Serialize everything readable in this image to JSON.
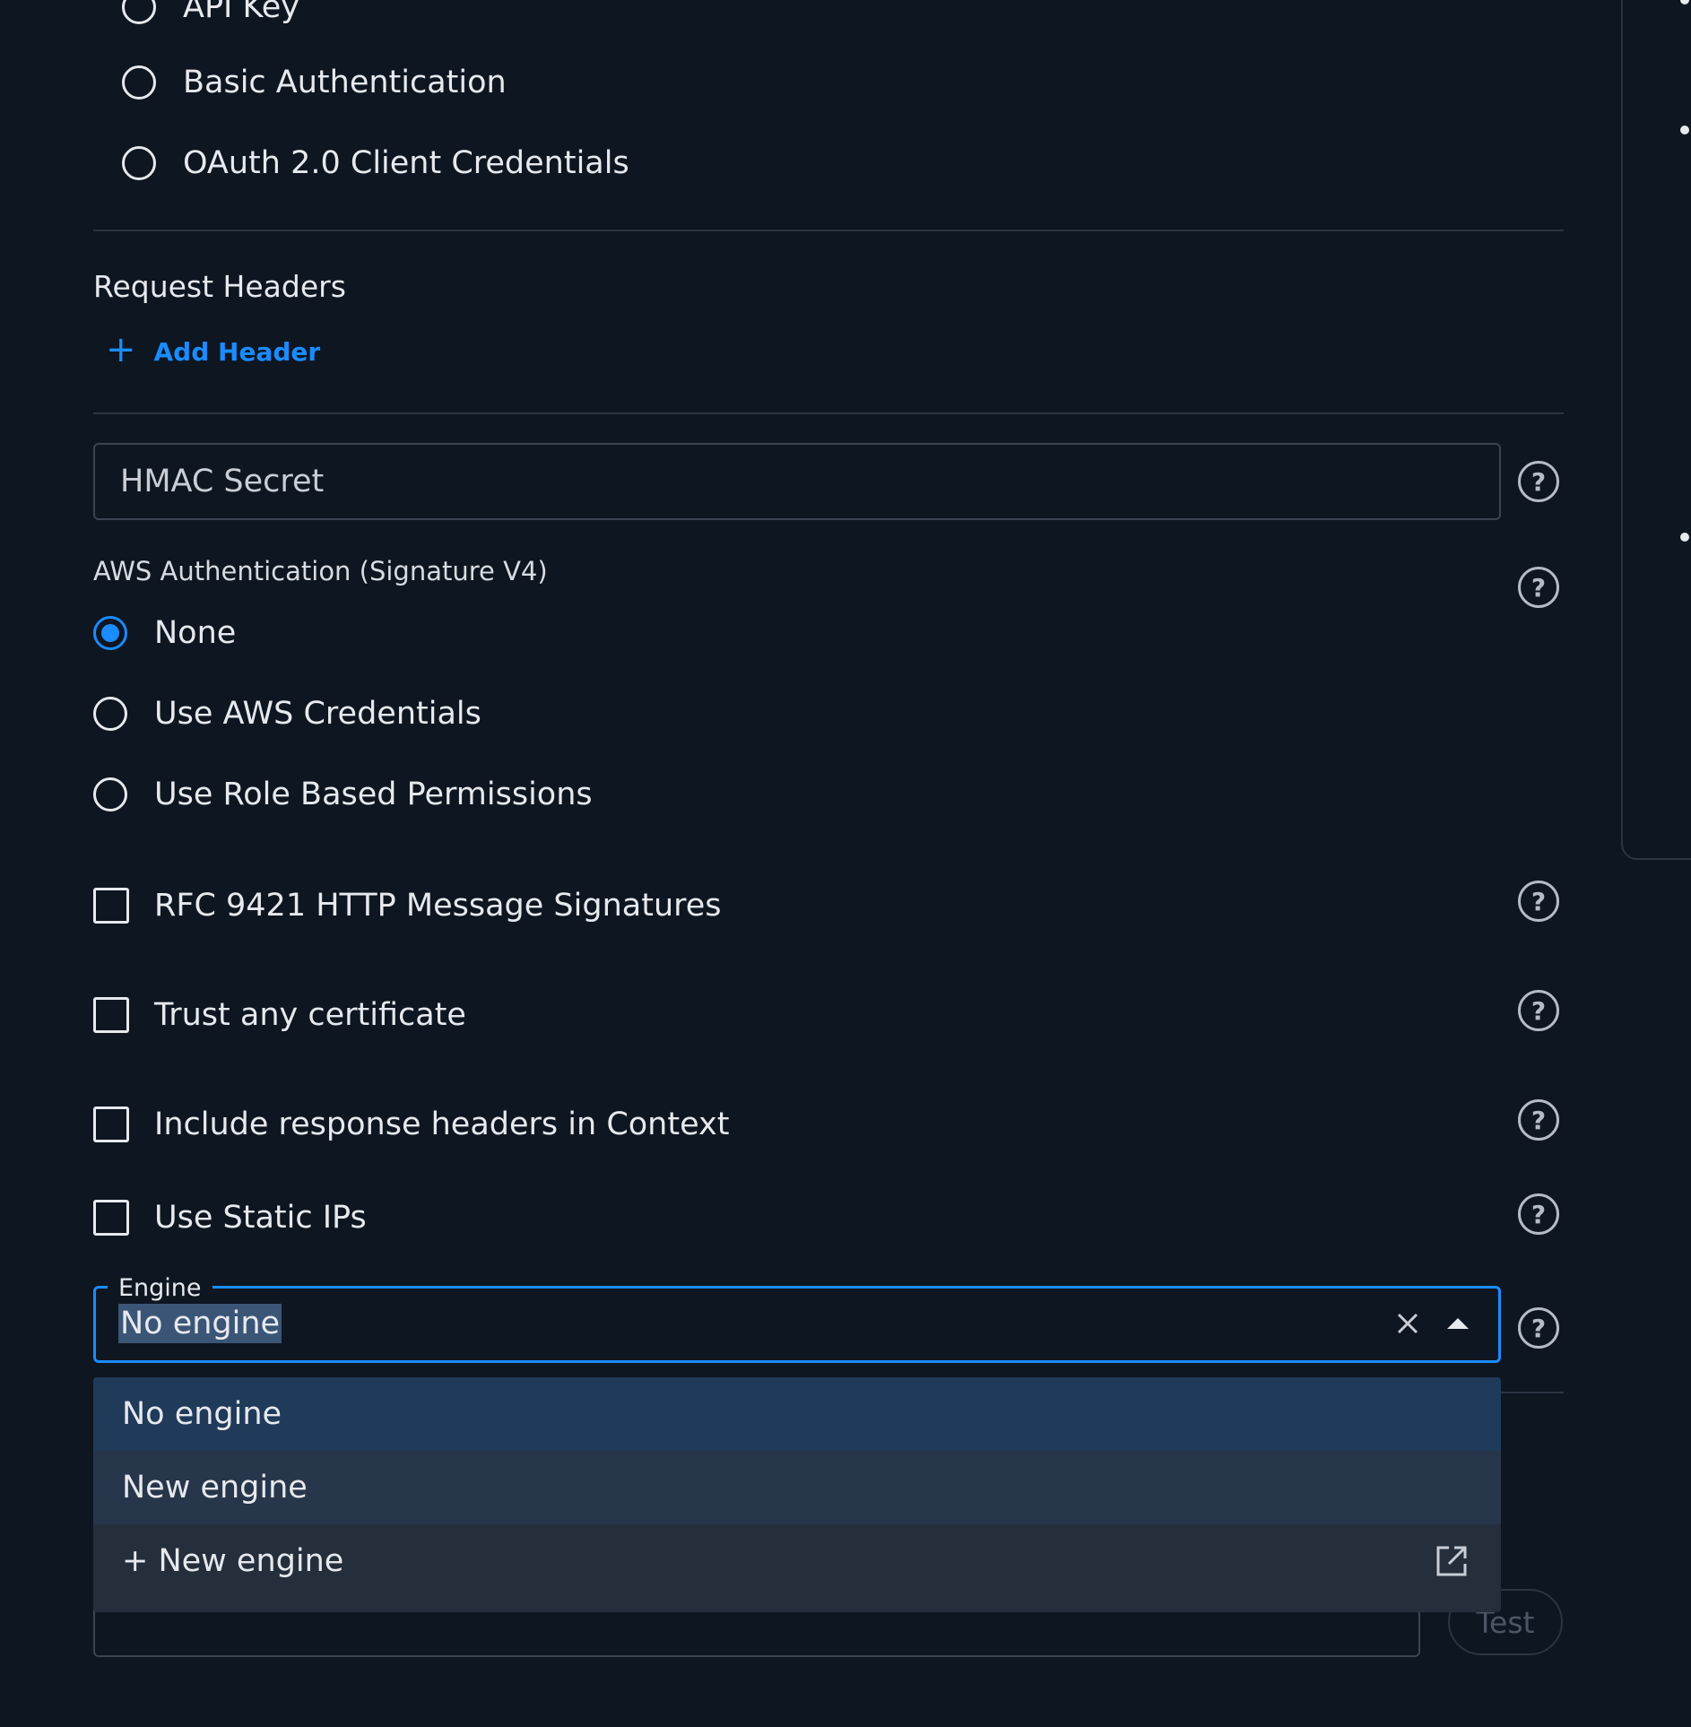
{
  "auth_type": {
    "options": [
      {
        "label": "API Key",
        "checked": false
      },
      {
        "label": "Basic Authentication",
        "checked": false
      },
      {
        "label": "OAuth 2.0 Client Credentials",
        "checked": false
      }
    ]
  },
  "request_headers": {
    "title": "Request Headers",
    "add_label": "Add Header"
  },
  "hmac": {
    "placeholder": "HMAC Secret"
  },
  "aws_auth": {
    "label": "AWS Authentication (Signature V4)",
    "options": [
      {
        "label": "None",
        "checked": true
      },
      {
        "label": "Use AWS Credentials",
        "checked": false
      },
      {
        "label": "Use Role Based Permissions",
        "checked": false
      }
    ]
  },
  "checkboxes": [
    {
      "label": "RFC 9421 HTTP Message Signatures",
      "checked": false
    },
    {
      "label": "Trust any certificate",
      "checked": false
    },
    {
      "label": "Include response headers in Context",
      "checked": false
    },
    {
      "label": "Use Static IPs",
      "checked": false
    }
  ],
  "engine": {
    "label": "Engine",
    "value": "No engine",
    "options": [
      {
        "label": "No engine",
        "state": "selected"
      },
      {
        "label": "New engine",
        "state": "hover"
      },
      {
        "label": "+ New engine",
        "state": "action",
        "icon": "external-link-icon"
      }
    ]
  },
  "test_button": {
    "label": "Test"
  },
  "colors": {
    "background": "#0e1621",
    "accent": "#1a8cff",
    "divider": "#2a3442",
    "dropdown": "#252f3c",
    "dropdown_selected": "#203a59"
  }
}
